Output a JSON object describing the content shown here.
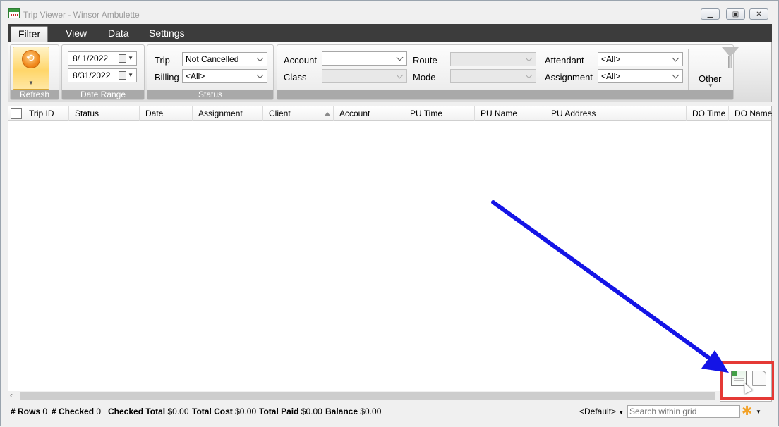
{
  "window": {
    "title": "Trip Viewer - Winsor Ambulette"
  },
  "menu": {
    "tabs": [
      "Filter",
      "View",
      "Data",
      "Settings"
    ]
  },
  "ribbon": {
    "refresh_label": "Refresh",
    "date_range": {
      "start": "8/  1/2022",
      "end": "8/31/2022",
      "label": "Date Range"
    },
    "status": {
      "trip_label": "Trip",
      "trip_value": "Not Cancelled",
      "billing_label": "Billing",
      "billing_value": "<All>",
      "label": "Status"
    },
    "filters": {
      "account_label": "Account",
      "account_value": "",
      "class_label": "Class",
      "class_value": "",
      "route_label": "Route",
      "route_value": "",
      "mode_label": "Mode",
      "mode_value": "",
      "attendant_label": "Attendant",
      "attendant_value": "<All>",
      "assignment_label": "Assignment",
      "assignment_value": "<All>"
    },
    "other_label": "Other"
  },
  "grid": {
    "columns": [
      "Trip ID",
      "Status",
      "Date",
      "Assignment",
      "Client",
      "Account",
      "PU Time",
      "PU Name",
      "PU Address",
      "DO Time",
      "DO Name"
    ]
  },
  "statusbar": {
    "rows_label": "# Rows",
    "rows_value": "0",
    "checked_label": "# Checked",
    "checked_value": "0",
    "checked_total_label": "Checked Total",
    "checked_total_value": "$0.00",
    "total_cost_label": "Total Cost",
    "total_cost_value": "$0.00",
    "total_paid_label": "Total Paid",
    "total_paid_value": "$0.00",
    "balance_label": "Balance",
    "balance_value": "$0.00",
    "layout_value": "<Default>",
    "search_placeholder": "Search within grid"
  },
  "colors": {
    "annotation_arrow": "#1414e6",
    "highlight_box": "#e53935",
    "menubar": "#3c3c3c"
  },
  "icons": [
    "app-calendar-icon",
    "refresh-icon",
    "calendar-icon",
    "funnel-icon",
    "export-excel-icon",
    "document-icon",
    "asterisk-icon",
    "mouse-cursor-icon"
  ]
}
